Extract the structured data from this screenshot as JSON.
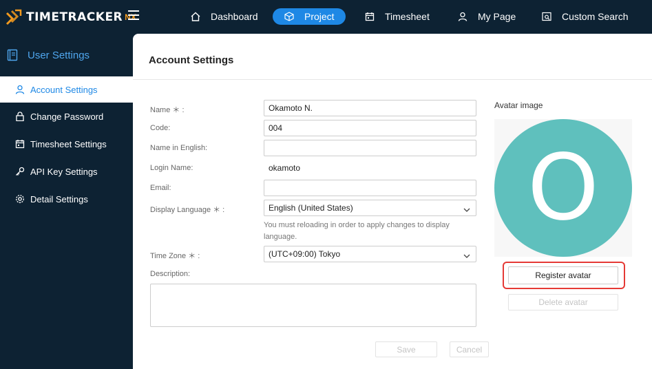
{
  "app": {
    "logo_text": "TIMETRACKER",
    "logo_suffix": "NX"
  },
  "nav": [
    {
      "label": "Dashboard",
      "icon": "home-icon"
    },
    {
      "label": "Project",
      "icon": "cube-icon",
      "active": true
    },
    {
      "label": "Timesheet",
      "icon": "calendar-icon"
    },
    {
      "label": "My Page",
      "icon": "user-icon"
    },
    {
      "label": "Custom Search",
      "icon": "search-window-icon"
    }
  ],
  "sidebar": {
    "heading": "User Settings",
    "items": [
      {
        "label": "Account Settings",
        "icon": "user-icon",
        "active": true
      },
      {
        "label": "Change Password",
        "icon": "lock-icon"
      },
      {
        "label": "Timesheet Settings",
        "icon": "calendar-icon"
      },
      {
        "label": "API Key Settings",
        "icon": "key-icon"
      },
      {
        "label": "Detail Settings",
        "icon": "gear-icon"
      }
    ]
  },
  "main": {
    "title": "Account Settings",
    "fields": {
      "name": {
        "label": "Name ＊ :",
        "value": "Okamoto N."
      },
      "code": {
        "label": "Code:",
        "value": "004"
      },
      "name_en": {
        "label": "Name in English:",
        "value": ""
      },
      "login": {
        "label": "Login Name:",
        "value": "okamoto"
      },
      "email": {
        "label": "Email:",
        "value": ""
      },
      "language": {
        "label": "Display Language ＊ :",
        "value": "English (United States)",
        "hint": "You must reloading in order to apply changes to display language."
      },
      "timezone": {
        "label": "Time Zone ＊ :",
        "value": "(UTC+09:00) Tokyo"
      },
      "description": {
        "label": "Description:",
        "value": ""
      }
    },
    "buttons": {
      "save": "Save",
      "cancel": "Cancel"
    },
    "avatar": {
      "label": "Avatar image",
      "initial": "O",
      "register": "Register avatar",
      "delete": "Delete avatar",
      "color": "#5fc0bd"
    }
  }
}
